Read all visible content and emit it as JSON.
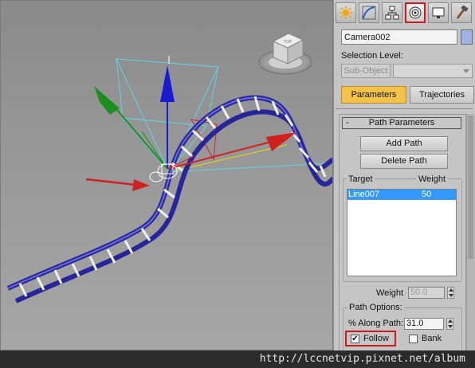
{
  "command_panel": {
    "tabs": [
      {
        "name": "create",
        "icon": "sun-create-icon",
        "active": false
      },
      {
        "name": "modify",
        "icon": "modify-curve-icon",
        "active": false
      },
      {
        "name": "hierarchy",
        "icon": "hierarchy-icon",
        "active": false
      },
      {
        "name": "motion",
        "icon": "motion-icon",
        "active": true
      },
      {
        "name": "display",
        "icon": "display-icon",
        "active": false
      },
      {
        "name": "utilities",
        "icon": "hammer-icon",
        "active": false
      }
    ],
    "object_name": "Camera002",
    "object_color": "#9cb3e6",
    "selection_level_label": "Selection Level:",
    "sub_object_button": "Sub-Object",
    "sub_object_dropdown_value": "",
    "subtabs": {
      "parameters": "Parameters",
      "trajectories": "Trajectories"
    },
    "rollout": {
      "collapse_symbol": "-",
      "title": "Path Parameters",
      "add_path_button": "Add Path",
      "delete_path_button": "Delete Path",
      "target_column": "Target",
      "weight_column": "Weight",
      "targets": [
        {
          "name": "Line007",
          "weight": "50"
        }
      ],
      "weight_label": "Weight",
      "weight_value": "50.0",
      "path_options_title": "Path Options:",
      "along_path_label": "% Along Path:",
      "along_path_value": "31.0",
      "follow_label": "Follow",
      "follow_checked": true,
      "bank_label": "Bank",
      "bank_checked": false
    }
  },
  "viewport": {
    "viewcube_label": "TOP",
    "accent_colors": {
      "path": "#2a2aa0",
      "x_arrow": "#d02020",
      "y_arrow": "#1b8f1b",
      "z_arrow": "#1a1ad0",
      "target_line": "#e8d800"
    }
  },
  "watermark": "http://lccnetvip.pixnet.net/album"
}
